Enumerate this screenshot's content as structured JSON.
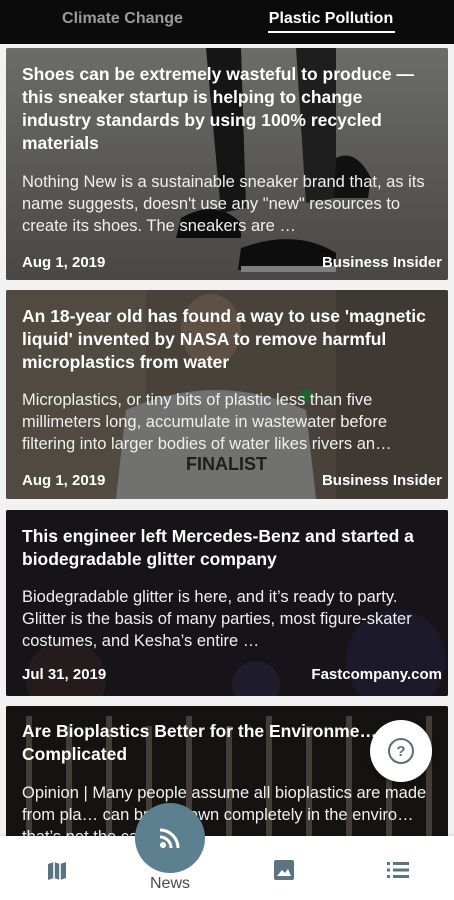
{
  "tabs": [
    {
      "label": "Climate Change",
      "active": false
    },
    {
      "label": "Plastic Pollution",
      "active": true
    }
  ],
  "articles": [
    {
      "title": "Shoes can be extremely wasteful to produce — this sneaker startup is helping to change industry standards by using 100% recycled materials",
      "description": "Nothing New is a sustainable sneaker brand that, as its name suggests, doesn't use any \"new\" resources to create its shoes. The sneakers are …",
      "date": "Aug 1, 2019",
      "source": "Business Insider"
    },
    {
      "title": "An 18-year old has found a way to use 'magnetic liquid' invented by NASA to remove harmful microplastics from water",
      "description": "Microplastics, or tiny bits of plastic less than five millimeters long, accumulate in wastewater before filtering into larger bodies of water likes rivers an…",
      "date": "Aug 1, 2019",
      "source": "Business Insider",
      "image_text": "FINALIST"
    },
    {
      "title": "This engineer left Mercedes-Benz and started a biodegradable glitter company",
      "description": "Biodegradable glitter is here, and it’s ready to party. Glitter is the basis of many parties, most figure-skater costumes, and Kesha’s entire …",
      "date": "Jul 31, 2019",
      "source": "Fastcompany.com"
    },
    {
      "title": "Are Bioplastics Better for the Environment? It's Complicated",
      "title_visible": "Are Bioplastics Better for the Environme… Complicated",
      "description": "Opinion | Many people assume all bioplastics are made from plants and can break down completely in the environment — that's not the case",
      "description_visible": "Opinion | Many people assume all bioplastics are made from pla… can break down completely in the enviro… that’s not the case"
    }
  ],
  "bottom_nav": {
    "items": [
      {
        "icon": "map-icon"
      },
      {
        "icon": "rss-icon",
        "label": "News",
        "active": true
      },
      {
        "icon": "image-icon"
      },
      {
        "icon": "list-icon"
      }
    ]
  },
  "help_button": {
    "icon": "help-icon",
    "glyph": "?"
  },
  "colors": {
    "tabbar_bg": "#0b0b0b",
    "accent": "#5d8090",
    "help_icon": "#53717d"
  }
}
